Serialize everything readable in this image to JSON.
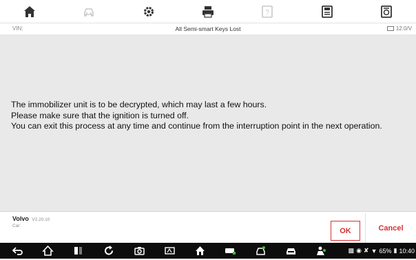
{
  "toolbar": {
    "items": [
      {
        "icon": "home-icon"
      },
      {
        "icon": "vehicle-icon"
      },
      {
        "icon": "settings-icon"
      },
      {
        "icon": "print-icon"
      },
      {
        "icon": "help-icon"
      },
      {
        "icon": "save-icon"
      },
      {
        "icon": "data-logging-icon"
      }
    ]
  },
  "info_bar": {
    "vin_label": "VIN:",
    "title": "All Semi-smart Keys Lost",
    "voltage": "12.0/V"
  },
  "message": {
    "lines": [
      "The immobilizer unit is to be decrypted, which may last a few hours.",
      "Please make sure that the ignition is turned off.",
      "You can exit this process at any time and continue from the interruption point in the next operation."
    ]
  },
  "footer": {
    "brand": "Volvo",
    "version": "V2.20.10",
    "car_label": "Car:",
    "ok_label": "OK",
    "cancel_label": "Cancel"
  },
  "system_bar": {
    "battery": "65%",
    "time": "10:40"
  },
  "colors": {
    "accent": "#d63030",
    "background": "#e9e9e9",
    "navbar": "#0d0d0d"
  }
}
